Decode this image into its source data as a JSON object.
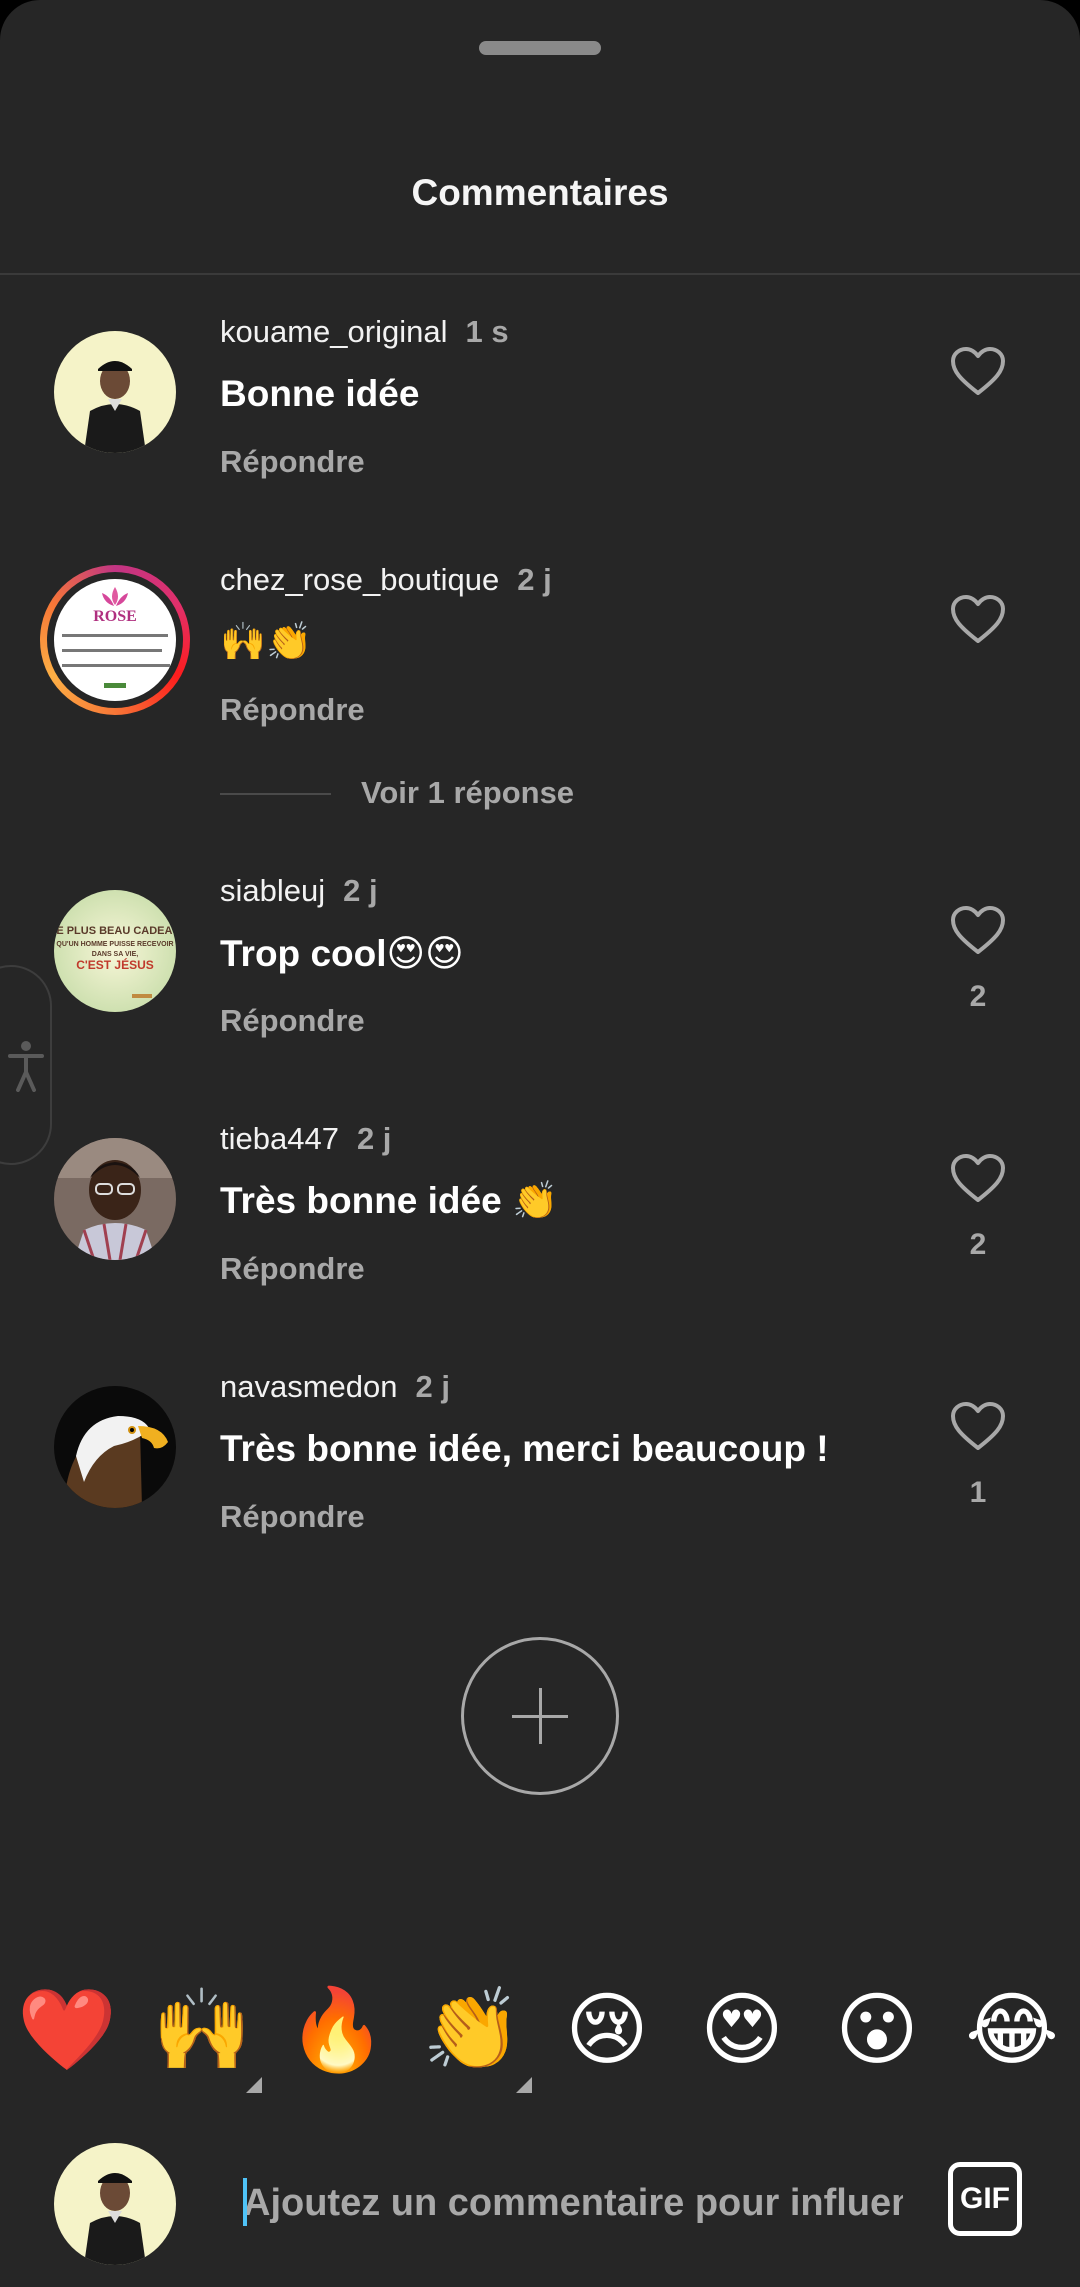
{
  "header": {
    "title": "Commentaires"
  },
  "comments": [
    {
      "username": "kouame_original",
      "time": "1 s",
      "text": "Bonne idée",
      "reply_label": "Répondre",
      "likes": ""
    },
    {
      "username": "chez_rose_boutique",
      "time": "2 j",
      "text": "🙌👏",
      "reply_label": "Répondre",
      "likes": "",
      "view_replies": "Voir 1 réponse"
    },
    {
      "username": "siableuj",
      "time": "2 j",
      "text": "Trop cool😍😍",
      "reply_label": "Répondre",
      "likes": "2"
    },
    {
      "username": "tieba447",
      "time": "2 j",
      "text": "Très bonne idée 👏",
      "reply_label": "Répondre",
      "likes": "2"
    },
    {
      "username": "navasmedon",
      "time": "2 j",
      "text": "Très bonne idée, merci beaucoup !",
      "reply_label": "Répondre",
      "likes": "1"
    }
  ],
  "avatar_texts": {
    "rose_brand": "ROSE",
    "siableuj_line1": "LE PLUS BEAU CADEAU",
    "siableuj_line2": "QU'UN HOMME PUISSE RECEVOIR",
    "siableuj_line3": "DANS SA VIE,",
    "siableuj_line4": "C'EST JÉSUS"
  },
  "reactions": [
    "❤️",
    "🙌",
    "🔥",
    "👏",
    "😢",
    "😍",
    "😮",
    "😂"
  ],
  "composer": {
    "placeholder": "Ajoutez un commentaire pour influenc",
    "gif_label": "GIF"
  },
  "colors": {
    "sheet_bg": "#262626",
    "secondary_text": "#a8a8a8",
    "caret": "#4fc3f7"
  }
}
